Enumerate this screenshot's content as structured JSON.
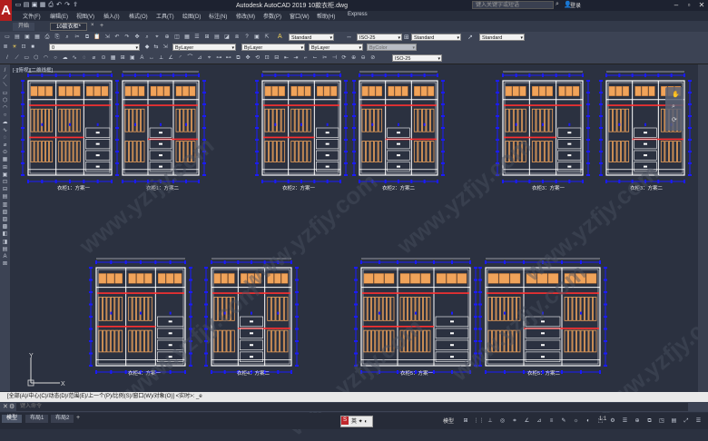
{
  "app": {
    "title": "Autodesk AutoCAD 2019    10款衣柜.dwg",
    "search_placeholder": "键入关键字或短语",
    "login_label": "登录",
    "logo_letter": "A"
  },
  "menus": [
    "文件(F)",
    "编辑(E)",
    "视图(V)",
    "插入(I)",
    "格式(O)",
    "工具(T)",
    "绘图(D)",
    "标注(N)",
    "修改(M)",
    "参数(P)",
    "窗口(W)",
    "帮助(H)",
    "Express"
  ],
  "tabs": [
    {
      "label": "开始",
      "active": false
    },
    {
      "label": "10款衣柜*",
      "active": true
    }
  ],
  "toolbar": {
    "text_style": "Standard",
    "dim_style": "ISO-25",
    "table_style": "Standard",
    "mleader_style": "Standard",
    "layer": "0",
    "color": "ByLayer",
    "linetype": "ByLayer",
    "lineweight": "ByLayer",
    "plotstyle": "ByColor",
    "dim_style2": "ISO-25"
  },
  "viewport_label": "[-][俯视][二维线框]",
  "watermark": "www.yzfjy.com",
  "drawings": [
    {
      "caption": "衣柜1：方案一"
    },
    {
      "caption": "衣柜1：方案二"
    },
    {
      "caption": "衣柜2：方案一"
    },
    {
      "caption": "衣柜2：方案二"
    },
    {
      "caption": "衣柜3：方案一"
    },
    {
      "caption": "衣柜3：方案二"
    },
    {
      "caption": "衣柜4：方案一"
    },
    {
      "caption": "衣柜4：方案二"
    },
    {
      "caption": "衣柜5：方案一"
    },
    {
      "caption": "衣柜5：方案二"
    }
  ],
  "command": {
    "history": "[全部(A)/中心(C)/动态(D)/范围(E)/上一个(P)/比例(S)/窗口(W)/对象(O)] <实时>: _e",
    "placeholder": "键入命令"
  },
  "layout_tabs": [
    "模型",
    "布局1",
    "布局2"
  ],
  "status": {
    "model": "模型",
    "scale": "1:1"
  },
  "colors": {
    "accent": "#b21e1e",
    "bg": "#2b3140",
    "line": "#ffffff",
    "wood": "#f0a35a",
    "dim": "#1a1aff",
    "shelf": "#ff3030"
  }
}
